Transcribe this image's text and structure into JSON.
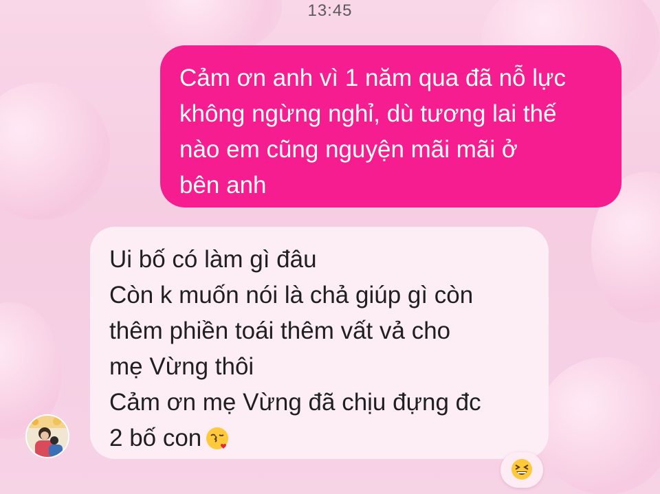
{
  "status_bar": {
    "time": "13:45"
  },
  "messages": [
    {
      "direction": "outgoing",
      "lines": [
        "Cảm ơn anh vì 1 năm qua đã nỗ lực",
        "không ngừng nghỉ, dù tương lai thế",
        "nào em cũng nguyện mãi mãi ở",
        "bên anh"
      ]
    },
    {
      "direction": "incoming",
      "lines": [
        "Ui bố có làm gì đâu",
        "Còn k muốn nói là chả giúp gì còn",
        "thêm phiền toái thêm vất vả cho",
        "mẹ Vừng thôi",
        "Cảm ơn mẹ Vừng đã chịu đựng đc",
        "2 bố con"
      ],
      "trailing_emoji": "face-blowing-kiss-icon",
      "reaction": "grinning-squinting-face-icon"
    }
  ],
  "colors": {
    "outgoing_bubble": "#f51d8f",
    "incoming_bubble": "#fdedf5",
    "background": "#f7cfe3"
  }
}
